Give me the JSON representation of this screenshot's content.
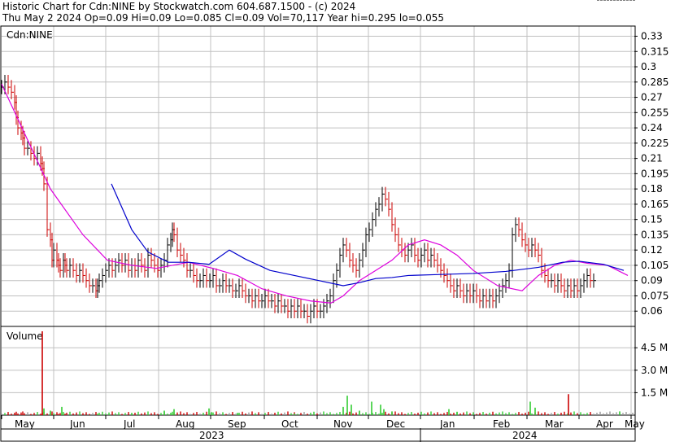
{
  "header": {
    "line1": "Historic Chart for Cdn:NINE by Stockwatch.com 604.687.1500 - (c) 2024",
    "line2": "Thu May  2 2024  Op=0.09  Hi=0.09  Lo=0.085  Cl=0.09  Vol=70,117  Year hi=0.295  lo=0.055"
  },
  "colors": {
    "up": "#000000",
    "down": "#cc0000",
    "ma_short": "#dd00dd",
    "ma_long": "#0000cc",
    "vol_up": "#33cc33",
    "vol_down": "#cc0000",
    "vol_flat": "#999999",
    "grid": "#c0c0c0"
  },
  "chart_data": [
    {
      "type": "line",
      "subtype": "ohlc-bars",
      "title": "Cdn:NINE",
      "ylim": [
        0.045,
        0.34
      ],
      "yticks": [
        0.33,
        0.315,
        0.3,
        0.285,
        0.27,
        0.255,
        0.24,
        0.225,
        0.21,
        0.195,
        0.18,
        0.165,
        0.15,
        0.135,
        0.12,
        0.105,
        0.09,
        0.075,
        0.06
      ],
      "ytick_labels": [
        "0.33",
        "0.315",
        "0.3",
        "0.285",
        "0.27",
        "0.255",
        "0.24",
        "0.225",
        "0.21",
        "0.195",
        "0.18",
        "0.165",
        "0.15",
        "0.135",
        "0.12",
        "0.105",
        "0.09",
        "0.075",
        "0.06"
      ],
      "grid": true,
      "x_months": [
        "May",
        "Jun",
        "Jul",
        "Aug",
        "Sep",
        "Oct",
        "Nov",
        "Dec",
        "Jan",
        "Feb",
        "Mar",
        "Apr",
        "May"
      ],
      "x_years": [
        "2023",
        "2024"
      ],
      "close_series": {
        "x": [
          0,
          4,
          8,
          12,
          16,
          18,
          20,
          24,
          26,
          28,
          32,
          36,
          40,
          44,
          48,
          50,
          52,
          56,
          60,
          62,
          64,
          68,
          70,
          72,
          76,
          78,
          80,
          84,
          88,
          92,
          96,
          100,
          104,
          108,
          112,
          116,
          118,
          120,
          124,
          128,
          132,
          136,
          140,
          144,
          148,
          152,
          156,
          160,
          164,
          168,
          172,
          176,
          180,
          184,
          188,
          192,
          196,
          200,
          204,
          208,
          210,
          212,
          216,
          220,
          224,
          228,
          232,
          236,
          240,
          244,
          248,
          252,
          256,
          260,
          264,
          268,
          272,
          276,
          280,
          284,
          288,
          292,
          296,
          300,
          304,
          308,
          312,
          316,
          320,
          324,
          328,
          332,
          336,
          340,
          344,
          348,
          352,
          356,
          360,
          364,
          368,
          372,
          376,
          380,
          384,
          388,
          392,
          396,
          400,
          404,
          408,
          412,
          416,
          420,
          424,
          428,
          432,
          436,
          440,
          444,
          448,
          452,
          456,
          460,
          464,
          468,
          472,
          476,
          480,
          484,
          488,
          492,
          496,
          500,
          504,
          508,
          512,
          516,
          520,
          524,
          528,
          532,
          536,
          540,
          544,
          548,
          552,
          556,
          560,
          564,
          568,
          572,
          576,
          580,
          584,
          588,
          592,
          596,
          600,
          604,
          608,
          612,
          616,
          620,
          624,
          628,
          632,
          636,
          640,
          644,
          648,
          652,
          656,
          660,
          664,
          668,
          672,
          676,
          680,
          684,
          688,
          692,
          696,
          700,
          704,
          708,
          712,
          716,
          720,
          724,
          728,
          732,
          736,
          740,
          744,
          748,
          752,
          756,
          760,
          764,
          768,
          772,
          776
        ],
        "close": [
          0.28,
          0.285,
          0.28,
          0.275,
          0.265,
          0.25,
          0.24,
          0.235,
          0.23,
          0.22,
          0.22,
          0.215,
          0.21,
          0.215,
          0.205,
          0.2,
          0.185,
          0.14,
          0.13,
          0.11,
          0.12,
          0.11,
          0.105,
          0.1,
          0.11,
          0.105,
          0.1,
          0.105,
          0.1,
          0.095,
          0.1,
          0.095,
          0.09,
          0.085,
          0.085,
          0.08,
          0.085,
          0.09,
          0.095,
          0.1,
          0.105,
          0.1,
          0.105,
          0.11,
          0.105,
          0.11,
          0.1,
          0.105,
          0.1,
          0.11,
          0.105,
          0.1,
          0.115,
          0.11,
          0.105,
          0.1,
          0.105,
          0.11,
          0.125,
          0.13,
          0.14,
          0.135,
          0.12,
          0.115,
          0.11,
          0.1,
          0.1,
          0.095,
          0.09,
          0.09,
          0.095,
          0.09,
          0.09,
          0.095,
          0.085,
          0.085,
          0.09,
          0.085,
          0.085,
          0.08,
          0.08,
          0.085,
          0.08,
          0.075,
          0.075,
          0.07,
          0.075,
          0.07,
          0.07,
          0.075,
          0.07,
          0.07,
          0.065,
          0.07,
          0.065,
          0.065,
          0.06,
          0.065,
          0.06,
          0.065,
          0.06,
          0.06,
          0.055,
          0.06,
          0.065,
          0.06,
          0.06,
          0.065,
          0.07,
          0.075,
          0.09,
          0.1,
          0.115,
          0.125,
          0.12,
          0.11,
          0.105,
          0.1,
          0.11,
          0.12,
          0.135,
          0.14,
          0.15,
          0.16,
          0.165,
          0.175,
          0.17,
          0.16,
          0.145,
          0.135,
          0.125,
          0.12,
          0.115,
          0.12,
          0.125,
          0.115,
          0.11,
          0.115,
          0.12,
          0.11,
          0.115,
          0.11,
          0.105,
          0.1,
          0.095,
          0.09,
          0.085,
          0.08,
          0.085,
          0.08,
          0.075,
          0.08,
          0.075,
          0.08,
          0.075,
          0.07,
          0.075,
          0.07,
          0.075,
          0.07,
          0.075,
          0.08,
          0.085,
          0.09,
          0.1,
          0.135,
          0.145,
          0.14,
          0.13,
          0.125,
          0.12,
          0.125,
          0.12,
          0.115,
          0.1,
          0.095,
          0.09,
          0.09,
          0.085,
          0.09,
          0.085,
          0.08,
          0.085,
          0.08,
          0.085,
          0.08,
          0.085,
          0.09,
          0.095,
          0.09,
          0.09
        ]
      },
      "ma_short": [
        [
          0,
          0.283
        ],
        [
          60,
          0.18
        ],
        [
          100,
          0.135
        ],
        [
          130,
          0.11
        ],
        [
          160,
          0.105
        ],
        [
          190,
          0.102
        ],
        [
          230,
          0.108
        ],
        [
          260,
          0.102
        ],
        [
          290,
          0.095
        ],
        [
          320,
          0.082
        ],
        [
          350,
          0.075
        ],
        [
          380,
          0.07
        ],
        [
          405,
          0.068
        ],
        [
          420,
          0.075
        ],
        [
          440,
          0.09
        ],
        [
          460,
          0.1
        ],
        [
          480,
          0.11
        ],
        [
          500,
          0.125
        ],
        [
          520,
          0.13
        ],
        [
          540,
          0.125
        ],
        [
          560,
          0.115
        ],
        [
          580,
          0.1
        ],
        [
          610,
          0.085
        ],
        [
          640,
          0.08
        ],
        [
          660,
          0.095
        ],
        [
          680,
          0.105
        ],
        [
          700,
          0.11
        ],
        [
          720,
          0.107
        ],
        [
          745,
          0.105
        ],
        [
          770,
          0.095
        ]
      ],
      "ma_long": [
        [
          135,
          0.185
        ],
        [
          160,
          0.14
        ],
        [
          180,
          0.118
        ],
        [
          205,
          0.108
        ],
        [
          230,
          0.108
        ],
        [
          255,
          0.106
        ],
        [
          280,
          0.12
        ],
        [
          300,
          0.111
        ],
        [
          330,
          0.1
        ],
        [
          360,
          0.095
        ],
        [
          390,
          0.09
        ],
        [
          420,
          0.085
        ],
        [
          440,
          0.088
        ],
        [
          460,
          0.092
        ],
        [
          480,
          0.093
        ],
        [
          500,
          0.095
        ],
        [
          540,
          0.096
        ],
        [
          580,
          0.097
        ],
        [
          620,
          0.099
        ],
        [
          660,
          0.103
        ],
        [
          690,
          0.108
        ],
        [
          710,
          0.109
        ],
        [
          740,
          0.106
        ],
        [
          765,
          0.1
        ]
      ]
    },
    {
      "type": "bar",
      "title": "Volume",
      "ylim": [
        0,
        5.6
      ],
      "yticks": [
        4.5,
        3.0,
        1.5
      ],
      "ytick_labels": [
        "4.5 M",
        "3.0 M",
        "1.5 M"
      ],
      "unit": "M",
      "spikes": [
        [
          50,
          5.6
        ],
        [
          52,
          0.45
        ],
        [
          60,
          0.3
        ],
        [
          74,
          0.55
        ],
        [
          160,
          0.15
        ],
        [
          200,
          0.3
        ],
        [
          212,
          0.4
        ],
        [
          255,
          0.45
        ],
        [
          258,
          0.2
        ],
        [
          290,
          0.15
        ],
        [
          360,
          0.1
        ],
        [
          420,
          0.55
        ],
        [
          425,
          1.3
        ],
        [
          430,
          0.7
        ],
        [
          440,
          0.3
        ],
        [
          455,
          0.9
        ],
        [
          466,
          0.7
        ],
        [
          470,
          0.4
        ],
        [
          480,
          0.25
        ],
        [
          550,
          0.4
        ],
        [
          560,
          0.2
        ],
        [
          650,
          0.9
        ],
        [
          656,
          0.5
        ],
        [
          697,
          1.4
        ],
        [
          760,
          0.25
        ]
      ]
    }
  ]
}
